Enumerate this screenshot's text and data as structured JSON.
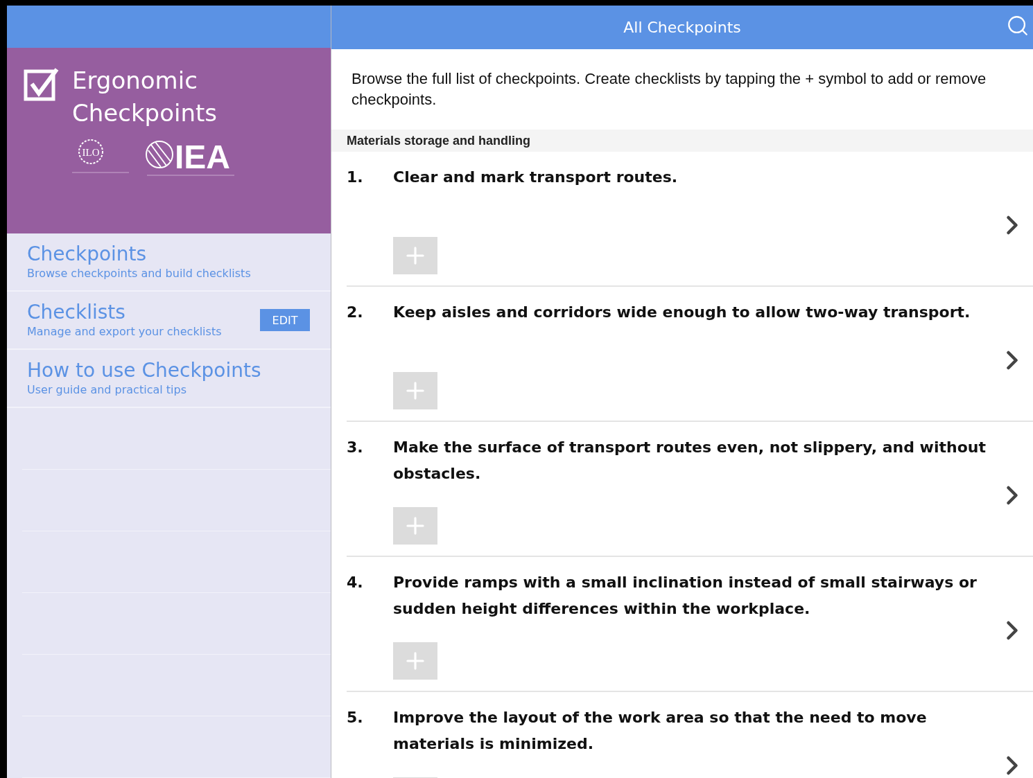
{
  "sidebar": {
    "app_title": [
      "Ergonomic",
      "Checkpoints"
    ],
    "logos": [
      {
        "kind": "ilo",
        "text": "ILO"
      },
      {
        "kind": "iea",
        "text": "IEA"
      }
    ],
    "items": [
      {
        "title": "Checkpoints",
        "subtitle": "Browse checkpoints and build checklists"
      },
      {
        "title": "Checklists",
        "subtitle": "Manage and export your checklists",
        "button": "EDIT"
      },
      {
        "title": "How to use Checkpoints",
        "subtitle": "User guide and practical tips"
      }
    ]
  },
  "header": {
    "title": "All Checkpoints"
  },
  "intro": "Browse the full list of checkpoints. Create checklists by tapping the + symbol to add or remove checkpoints.",
  "section": "Materials storage and handling",
  "checkpoints": [
    {
      "number": "1.",
      "title": "Clear and mark transport routes."
    },
    {
      "number": "2.",
      "title": "Keep aisles and corridors wide enough to allow two-way transport."
    },
    {
      "number": "3.",
      "title": "Make the surface of transport routes even, not slippery, and without obstacles."
    },
    {
      "number": "4.",
      "title": "Provide ramps with a small inclination instead of small stairways or sudden height differences within the workplace."
    },
    {
      "number": "5.",
      "title": "Improve the layout of the work area so that the need to move materials is minimized."
    }
  ]
}
